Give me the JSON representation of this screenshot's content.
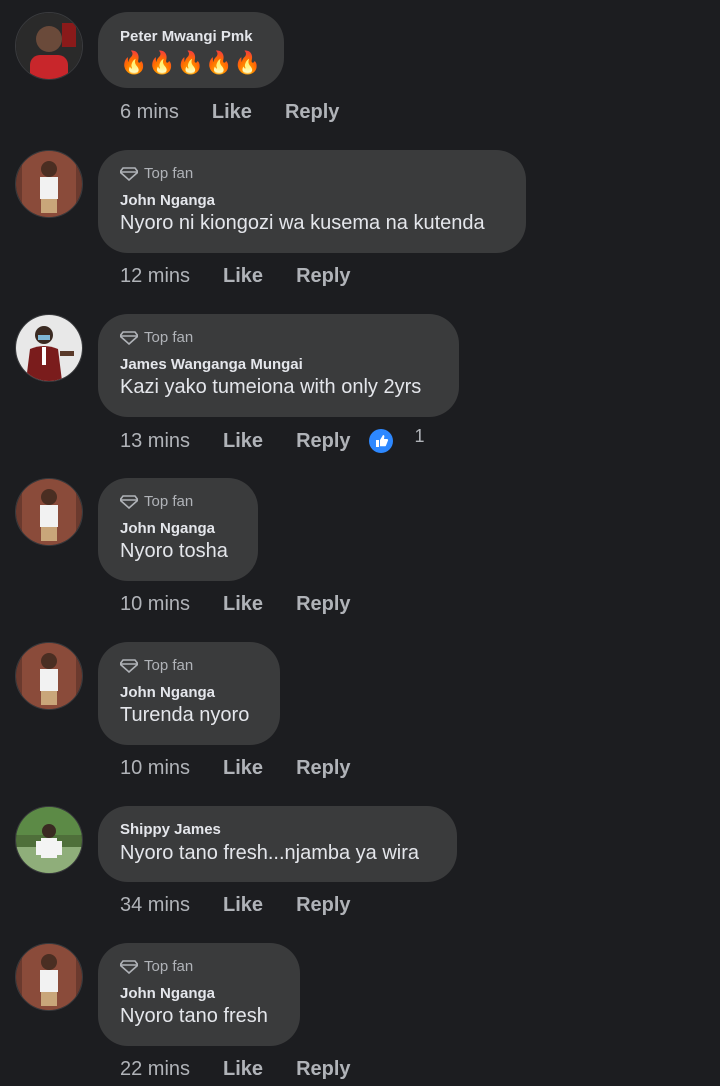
{
  "comments": [
    {
      "badge": "",
      "name": "Peter Mwangi Pmk",
      "text": "🔥🔥🔥🔥🔥",
      "time": "6 mins",
      "like": "Like",
      "reply": "Reply"
    },
    {
      "badge": "Top fan",
      "name": "John Nganga",
      "text": "Nyoro ni kiongozi wa kusema na kutenda",
      "time": "12 mins",
      "like": "Like",
      "reply": "Reply"
    },
    {
      "badge": "Top fan",
      "name": "James Wanganga Mungai",
      "text": "Kazi yako tumeiona with only 2yrs",
      "time": "13 mins",
      "like": "Like",
      "reply": "Reply",
      "reaction_count": "1"
    },
    {
      "badge": "Top fan",
      "name": "John Nganga",
      "text": "Nyoro tosha",
      "time": "10 mins",
      "like": "Like",
      "reply": "Reply"
    },
    {
      "badge": "Top fan",
      "name": "John Nganga",
      "text": "Turenda nyoro",
      "time": "10 mins",
      "like": "Like",
      "reply": "Reply"
    },
    {
      "badge": "",
      "name": "Shippy James",
      "text": "Nyoro tano fresh...njamba ya wira",
      "time": "34 mins",
      "like": "Like",
      "reply": "Reply"
    },
    {
      "badge": "Top fan",
      "name": "John Nganga",
      "text": "Nyoro tano fresh",
      "time": "22 mins",
      "like": "Like",
      "reply": "Reply"
    }
  ],
  "colors": {
    "background": "#1c1d20",
    "bubble": "#3a3b3c",
    "muted": "#b0b3b8",
    "like_blue": "#2d88ff"
  }
}
